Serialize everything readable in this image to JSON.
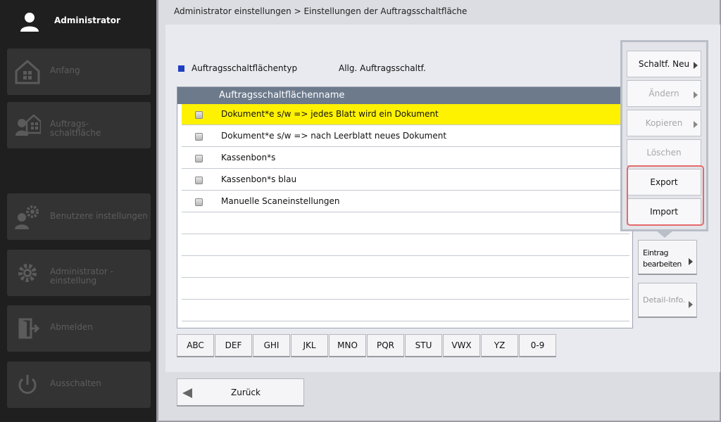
{
  "user": {
    "name": "Administrator"
  },
  "sidebar": {
    "items": [
      {
        "label": "Anfang",
        "icon": "home-icon"
      },
      {
        "label1": "Auftrags-",
        "label2": "schaltfläche",
        "icon": "job-button-icon"
      },
      {
        "label": "Benutzere instellungen",
        "icon": "user-settings-icon"
      },
      {
        "label1": "Administrator -",
        "label2": "einstellung",
        "icon": "gear-icon"
      },
      {
        "label": "Abmelden",
        "icon": "logout-icon"
      },
      {
        "label": "Ausschalten",
        "icon": "power-icon"
      }
    ]
  },
  "breadcrumb": "Administrator einstellungen > Einstellungen der Auftragsschaltfläche",
  "type": {
    "label": "Auftragsschaltflächentyp",
    "value": "Allg. Auftragsschaltf."
  },
  "table": {
    "header": "Auftragsschaltflächenname",
    "rows": [
      "Dokument*e s/w => jedes Blatt wird ein Dokument",
      "Dokument*e s/w => nach Leerblatt neues Dokument",
      "Kassenbon*s",
      "Kassenbon*s blau",
      "Manuelle Scaneinstellungen"
    ]
  },
  "alpha": [
    "ABC",
    "DEF",
    "GHI",
    "JKL",
    "MNO",
    "PQR",
    "STU",
    "VWX",
    "YZ",
    "0-9"
  ],
  "popup": {
    "new": "Schaltf. Neu",
    "change": "Ändern",
    "copy": "Kopieren",
    "delete": "Löschen",
    "export": "Export",
    "import": "Import"
  },
  "side": {
    "edit1": "Eintrag",
    "edit2": "bearbeiten",
    "detail": "Detail-Info."
  },
  "back": "Zurück",
  "colors": {
    "selected_row": "#fff200",
    "header": "#6c7a8c",
    "highlight_frame": "#e46a6a"
  }
}
